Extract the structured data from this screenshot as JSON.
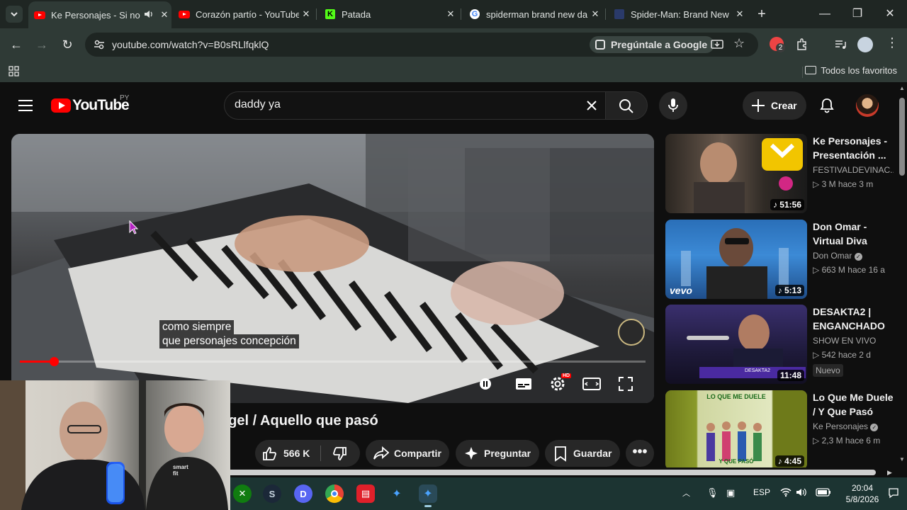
{
  "browser": {
    "tabs": [
      {
        "title": "Ke Personajes - Si no",
        "favicon": "youtube-icon",
        "active": true,
        "audio": true
      },
      {
        "title": "Corazón partío - YouTube",
        "favicon": "youtube-icon",
        "active": false
      },
      {
        "title": "Patada",
        "favicon": "kick-icon",
        "active": false
      },
      {
        "title": "spiderman brand new da",
        "favicon": "google-icon",
        "active": false
      },
      {
        "title": "Spider-Man: Brand New",
        "favicon": "site-icon",
        "active": false
      }
    ],
    "url": "youtube.com/watch?v=B0sRLlfqklQ",
    "ask_google": "Pregúntale a Google",
    "extension_badge": "2",
    "all_bookmarks": "Todos los favoritos"
  },
  "youtube": {
    "logo_text": "YouTube",
    "country_code": "PY",
    "search_value": "daddy ya",
    "create_label": "Crear",
    "player": {
      "caption_line1": "como siempre",
      "caption_line2": "que personajes concepción",
      "progress_fraction": 0.054,
      "quality_badge": "HD"
    },
    "video_title": "Ke Personajes - Si no estas / Angel / Aquello que pasó",
    "visible_title": "ngel / Aquello que pasó",
    "actions": {
      "likes": "566 K",
      "share": "Compartir",
      "ask": "Preguntar",
      "save": "Guardar"
    },
    "recommendations": [
      {
        "title": "Ke Personajes - Presentación ...",
        "channel": "FESTIVALDEVINAC...",
        "views": "3 M",
        "age": "hace 3 m",
        "duration": "51:56",
        "music": true,
        "verified": false,
        "badge": ""
      },
      {
        "title": "Don Omar - Virtual Diva",
        "channel": "Don Omar",
        "views": "663 M",
        "age": "hace 16 a",
        "duration": "5:13",
        "music": true,
        "verified": true,
        "badge": ""
      },
      {
        "title": "DESAKTA2 | ENGANCHADO ...",
        "channel": "SHOW EN VIVO",
        "views": "542",
        "age": "hace 2 d",
        "duration": "11:48",
        "music": false,
        "verified": false,
        "badge": "Nuevo"
      },
      {
        "title": "Lo Que Me Duele / Y Que Pasó",
        "channel": "Ke Personajes",
        "views": "2,3 M",
        "age": "hace 6 m",
        "duration": "4:45",
        "music": true,
        "verified": true,
        "badge": ""
      }
    ],
    "thumb_texts": {
      "vevo": "vevo",
      "desakta": "DESAKTA2",
      "lo_que_top": "LO QUE ME DUELE",
      "lo_que_bottom": "Y QUE PASÓ"
    }
  },
  "webcam": {
    "shirt_text": "smart fit"
  },
  "taskbar": {
    "language": "ESP",
    "time": "20:04",
    "date": "5/8/2026"
  }
}
